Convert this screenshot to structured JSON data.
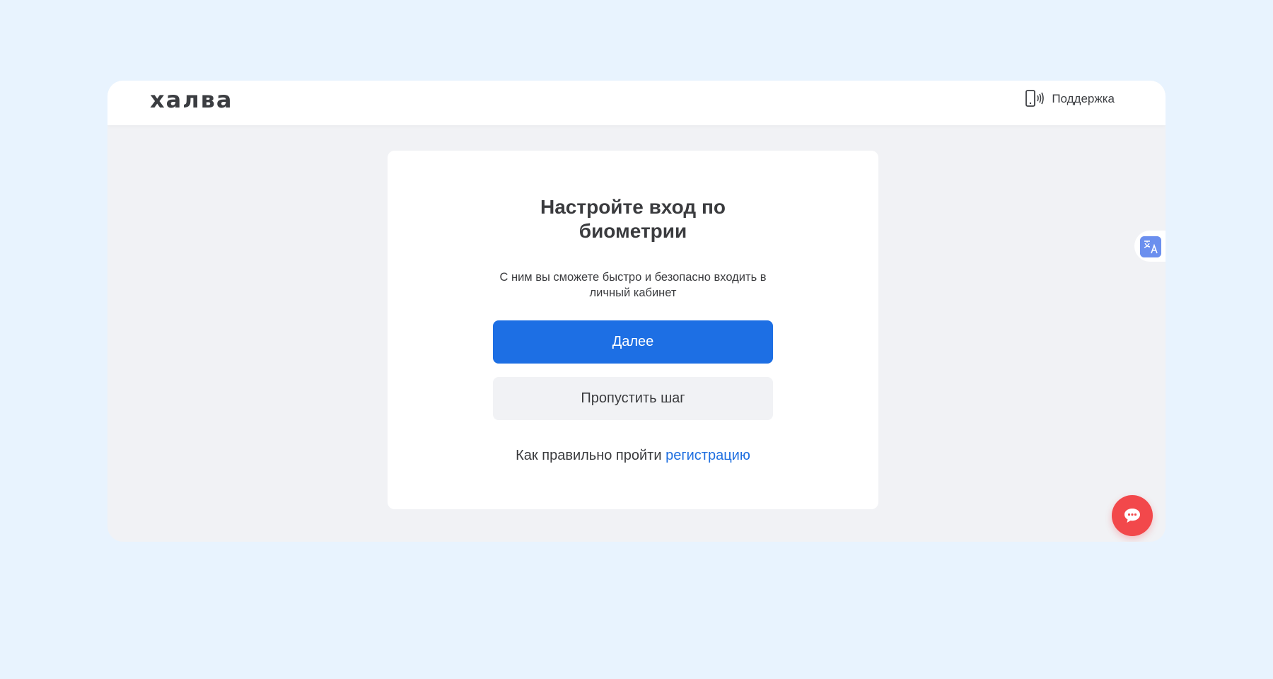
{
  "header": {
    "logo_text": "халва",
    "support_icon": "phone-vibrate-icon",
    "support_label": "Поддержка"
  },
  "card": {
    "title_line1": "Настройте вход по",
    "title_line2": "биометрии",
    "subtitle": "С ним вы сможете быстро и безопасно входить в личный кабинет",
    "primary_button": "Далее",
    "secondary_button": "Пропустить шаг",
    "help_prefix": "Как правильно пройти",
    "help_link": "регистрацию"
  },
  "widgets": {
    "translate_icon": "translate-icon",
    "chat_icon": "chat-bubble-icon"
  },
  "colors": {
    "page_background": "#e8f3fe",
    "primary_button": "#1d6fe4",
    "link": "#1f6fe0",
    "chat_button": "#f2484b",
    "translate_badge": "#6b8fee"
  }
}
